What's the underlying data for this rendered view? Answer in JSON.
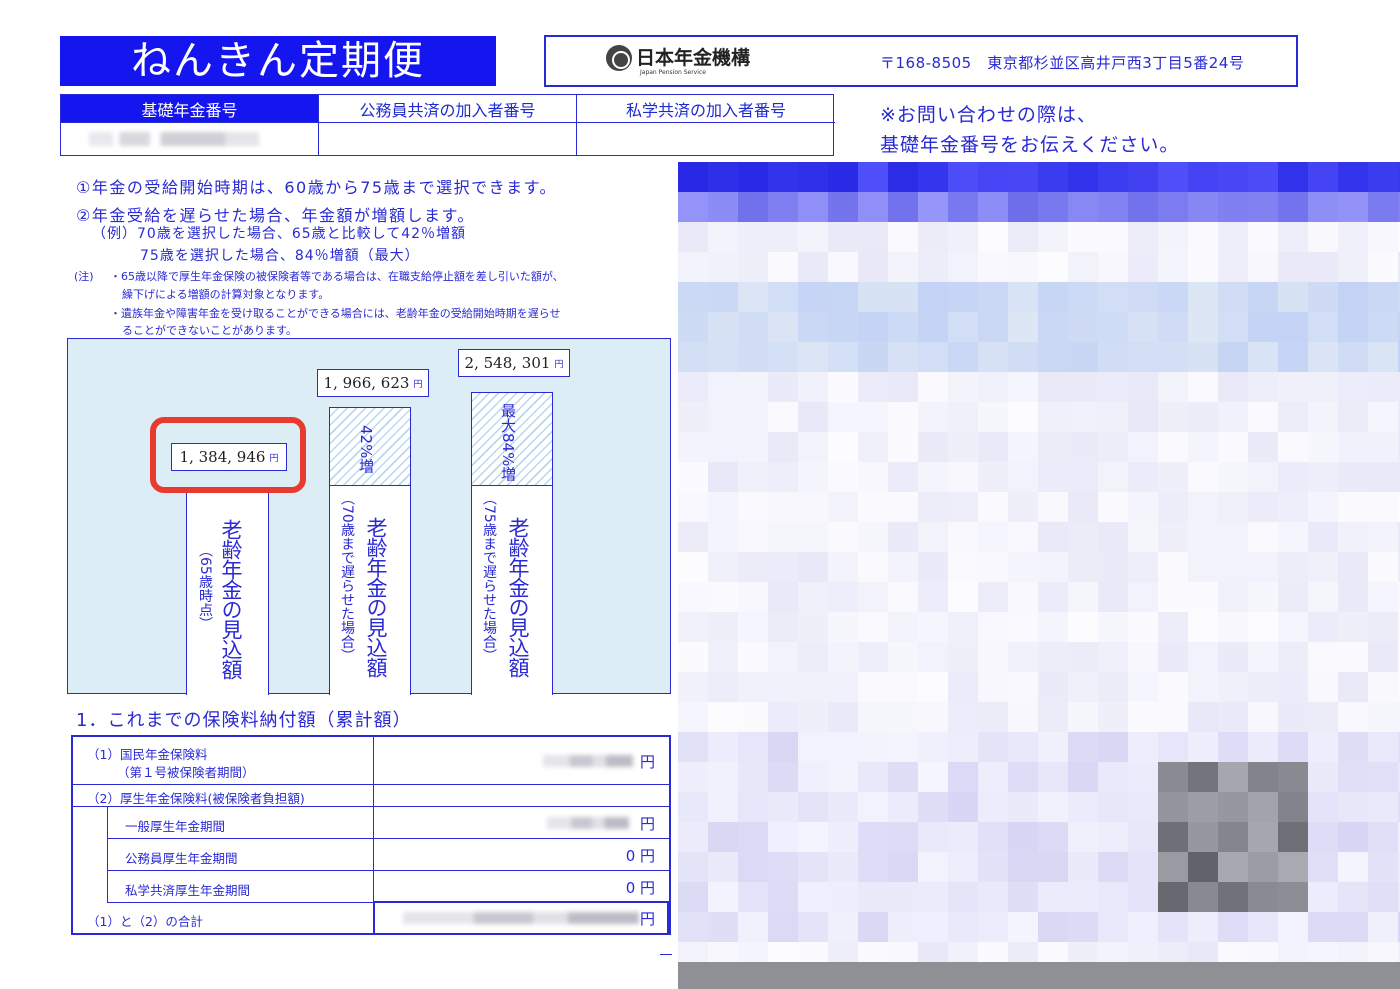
{
  "title": "ねんきん定期便",
  "organization": {
    "name": "日本年金機構",
    "name_en": "Japan Pension Service",
    "address": "〒168-8505　東京都杉並区高井戸西3丁目5番24号",
    "logo_icon": "jps-logo-icon"
  },
  "pension_numbers": {
    "headers": [
      "基礎年金番号",
      "公務員共済の加入者番号",
      "私学共済の加入者番号"
    ]
  },
  "inquiry": [
    "※お問い合わせの際は、",
    "基礎年金番号をお伝えください。"
  ],
  "notes": {
    "point1": "①年金の受給開始時期は、60歳から75歳まで選択できます。",
    "point2": "②年金受給を遅らせた場合、年金額が増額します。",
    "example1": "（例）70歳を選択した場合、65歳と比較して42％増額",
    "example2": "75歳を選択した場合、84％増額（最大）",
    "caution_label": "(注)",
    "caution1_a": "・65歳以降で厚生年金保険の被保険者等である場合は、在職支給停止額を差し引いた額が、",
    "caution1_b": "繰下げによる増額の計算対象となります。",
    "caution2_a": "・遺族年金や障害年金を受け取ることができる場合には、老齢年金の受給開始時期を遅らせ",
    "caution2_b": "ることができないことがあります。"
  },
  "chart_data": {
    "type": "bar",
    "categories": [
      "老齢年金の見込額（65歳時点）",
      "老齢年金の見込額（70歳まで遅らせた場合）",
      "老齢年金の見込額（75歳まで遅らせた場合）"
    ],
    "values": [
      1384946,
      1966623,
      2548301
    ],
    "value_labels": [
      "1, 384, 946",
      "1, 966, 623",
      "2, 548, 301"
    ],
    "unit": "円",
    "increase_labels": [
      "",
      "42%増",
      "最大84%増"
    ],
    "bar_main_label": "老齢年金の見込額",
    "bar_sub_labels": [
      "（65歳時点）",
      "（70歳まで遅らせた場合）",
      "（75歳まで遅らせた場合）"
    ],
    "highlight_color": "#e83a2e"
  },
  "section1": {
    "title": "1．これまでの保険料納付額（累計額）",
    "rows": [
      {
        "label_a": "（1）国民年金保険料",
        "label_b": "（第１号被保険者期間）",
        "value": "円"
      },
      {
        "label_a": "（2）厚生年金保険料(被保険者負担額)",
        "value": ""
      },
      {
        "label_a": "一般厚生年金期間",
        "value": "円"
      },
      {
        "label_a": "公務員厚生年金期間",
        "value": "0 円"
      },
      {
        "label_a": "私学共済厚生年金期間",
        "value": "0 円"
      },
      {
        "label_a": "（1）と（2）の合計",
        "value": "円"
      }
    ]
  },
  "colors": {
    "primary": "#1515f0",
    "text": "#2a2ad4",
    "chart_bg": "#dcedf6",
    "highlight": "#e83a2e"
  }
}
